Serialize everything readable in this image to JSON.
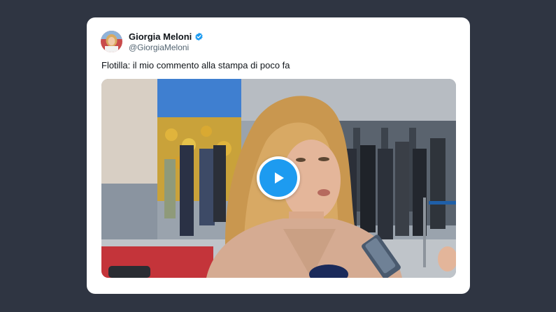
{
  "tweet": {
    "author_name": "Giorgia Meloni",
    "author_handle": "@GiorgiaMeloni",
    "verified": true,
    "text": "Flotilla: il mio commento alla stampa di poco fa"
  },
  "media": {
    "type": "video",
    "play_icon": "play-icon"
  },
  "colors": {
    "background": "#2f3542",
    "card": "#ffffff",
    "verified_badge": "#1d9bf0",
    "play_button": "#1d9bf0",
    "name_text": "#0f1419",
    "handle_text": "#536471"
  }
}
